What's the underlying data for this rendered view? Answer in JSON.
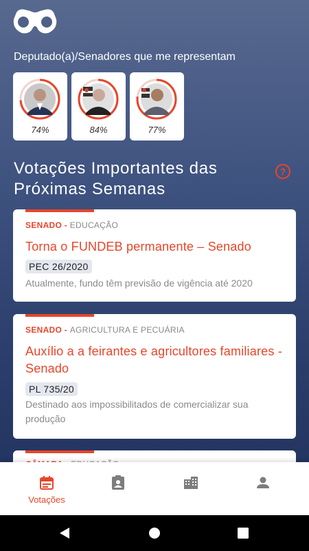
{
  "colors": {
    "accent": "#e8452a",
    "bg_top": "#58698f",
    "bg_bottom": "#20315d"
  },
  "header": {
    "logo_icon": "binoculars-icon"
  },
  "representatives": {
    "title": "Deputado(a)/Senadores que me representam",
    "items": [
      {
        "percent": "74%",
        "value": 74
      },
      {
        "percent": "84%",
        "value": 84
      },
      {
        "percent": "77%",
        "value": 77
      }
    ]
  },
  "section": {
    "title": "Votações Importantes das Próximas Semanas",
    "help_icon": "question-circle-icon"
  },
  "votes": [
    {
      "house": "SENADO",
      "sep": " - ",
      "category": "EDUCAÇÃO",
      "title": "Torna o FUNDEB permanente – Senado",
      "code": "PEC 26/2020",
      "description": "Atualmente, fundo têm previsão de vigência até 2020"
    },
    {
      "house": "SENADO",
      "sep": " - ",
      "category": "AGRICULTURA E PECUÁRIA",
      "title": "Auxílio a a feirantes e agricultores familiares - Senado",
      "code": "PL 735/20",
      "description": "Destinado aos impossibilitados de comercializar sua produção"
    },
    {
      "house": "CÂMARA",
      "sep": " - ",
      "category": "EDUCAÇÃO"
    }
  ],
  "bottom_nav": [
    {
      "label": "Votações",
      "icon": "calendar-icon",
      "active": true
    },
    {
      "label": "",
      "icon": "clipboard-person-icon",
      "active": false
    },
    {
      "label": "",
      "icon": "building-icon",
      "active": false
    },
    {
      "label": "",
      "icon": "person-icon",
      "active": false
    }
  ],
  "android_nav": {
    "back": "back-icon",
    "home": "home-icon",
    "recents": "recents-icon"
  }
}
